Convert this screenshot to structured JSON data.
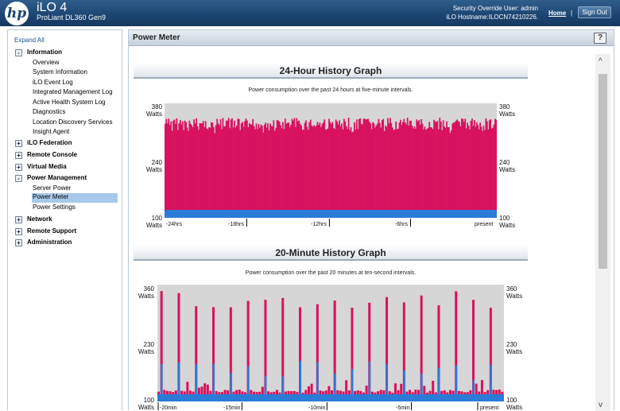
{
  "header": {
    "logo": "hp",
    "product": "iLO 4",
    "model": "ProLiant DL360 Gen9",
    "user_line": "Security Override User:  admin",
    "host_line": "iLO Hostname:ILOCN74210226.",
    "home_link": "Home",
    "separator": "|",
    "signout_label": "Sign Out",
    "colors": {
      "bar_top": "#2f5d8c",
      "bar_bottom": "#17385e"
    }
  },
  "sidebar": {
    "expand_all": "Expand All",
    "sections": [
      {
        "toggle": "-",
        "label": "Information",
        "items": [
          "Overview",
          "System Information",
          "iLO Event Log",
          "Integrated Management Log",
          "Active Health System Log",
          "Diagnostics",
          "Location Discovery Services",
          "Insight Agent"
        ]
      },
      {
        "toggle": "+",
        "label": "iLO Federation"
      },
      {
        "toggle": "+",
        "label": "Remote Console"
      },
      {
        "toggle": "+",
        "label": "Virtual Media"
      },
      {
        "toggle": "-",
        "label": "Power Management",
        "items": [
          "Server Power",
          "Power Meter",
          "Power Settings"
        ],
        "selected": "Power Meter"
      },
      {
        "toggle": "+",
        "label": "Network"
      },
      {
        "toggle": "+",
        "label": "Remote Support"
      },
      {
        "toggle": "+",
        "label": "Administration"
      }
    ]
  },
  "main": {
    "title": "Power Meter",
    "help": "?",
    "scroll_up": "^",
    "scroll_down": "v"
  },
  "graph24": {
    "title": "24-Hour History Graph",
    "subtitle": "Power consumption over the past 24 hours at five-minute intervals.",
    "y_labels": [
      {
        "value": "380",
        "unit": "Watts"
      },
      {
        "value": "240",
        "unit": "Watts"
      },
      {
        "value": "100",
        "unit": "Watts"
      }
    ],
    "x_ticks": [
      "-24hrs",
      "-18hrs",
      "-12hrs",
      "-6hrs",
      "present"
    ]
  },
  "graph20": {
    "title": "20-Minute History Graph",
    "subtitle": "Power consumption over the past 20 minutes at ten-second intervals.",
    "y_labels": [
      {
        "value": "360",
        "unit": "Watts"
      },
      {
        "value": "230",
        "unit": "Watts"
      },
      {
        "value": "100",
        "unit": "Watts"
      }
    ],
    "x_ticks": [
      "-20min",
      "-15min",
      "-10min",
      "-5min",
      "present"
    ]
  },
  "colors": {
    "peak": "#d8125e",
    "average": "#2b7bd9",
    "plot_bg": "#d6d6d6"
  }
}
